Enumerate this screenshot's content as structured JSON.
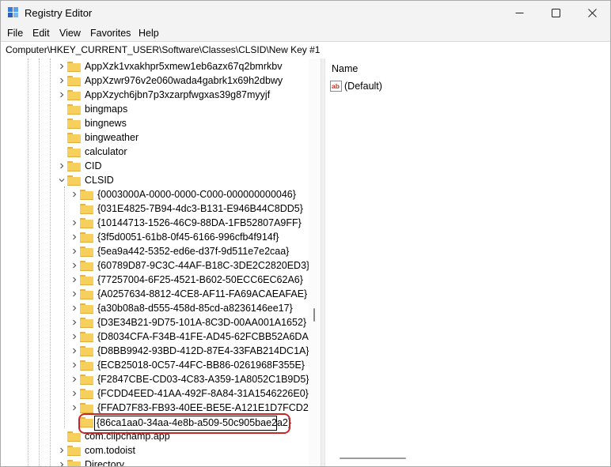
{
  "window": {
    "title": "Registry Editor",
    "icon": "registry-icon",
    "controls": [
      "minimize-icon",
      "maximize-icon",
      "close-icon"
    ]
  },
  "menu": [
    "File",
    "Edit",
    "View",
    "Favorites",
    "Help"
  ],
  "address": "Computer\\HKEY_CURRENT_USER\\Software\\Classes\\CLSID\\New Key #1",
  "tree": {
    "items": [
      {
        "label": "AppXzk1vxakhpr5xmew1eb6azx67q2bmrkbv",
        "expandable": true
      },
      {
        "label": "AppXzwr976v2e060wada4gabrk1x69h2dbwy",
        "expandable": true
      },
      {
        "label": "AppXzych6jbn7p3xzarpfwgxas39g87myyjf",
        "expandable": true
      },
      {
        "label": "bingmaps",
        "expandable": false
      },
      {
        "label": "bingnews",
        "expandable": false
      },
      {
        "label": "bingweather",
        "expandable": false
      },
      {
        "label": "calculator",
        "expandable": false
      },
      {
        "label": "CID",
        "expandable": true
      },
      {
        "label": "CLSID",
        "expandable": true,
        "expanded": true
      }
    ],
    "clsid_children": [
      {
        "label": "{0003000A-0000-0000-C000-000000000046}",
        "expandable": true
      },
      {
        "label": "{031E4825-7B94-4dc3-B131-E946B44C8DD5}",
        "expandable": false
      },
      {
        "label": "{10144713-1526-46C9-88DA-1FB52807A9FF}",
        "expandable": true
      },
      {
        "label": "{3f5d0051-61b8-0f45-6166-996cfb4f914f}",
        "expandable": true
      },
      {
        "label": "{5ea9a442-5352-ed6e-d37f-9d511e7e2caa}",
        "expandable": true
      },
      {
        "label": "{60789D87-9C3C-44AF-B18C-3DE2C2820ED3}",
        "expandable": true
      },
      {
        "label": "{77257004-6F25-4521-B602-50ECC6EC62A6}",
        "expandable": true
      },
      {
        "label": "{A0257634-8812-4CE8-AF11-FA69ACAEAFAE}",
        "expandable": true
      },
      {
        "label": "{a30b08a8-d555-458d-85cd-a8236146ee17}",
        "expandable": true
      },
      {
        "label": "{D3E34B21-9D75-101A-8C3D-00AA001A1652}",
        "expandable": true
      },
      {
        "label": "{D8034CFA-F34B-41FE-AD45-62FCBB52A6DA}",
        "expandable": true
      },
      {
        "label": "{D8BB9942-93BD-412D-87E4-33FAB214DC1A}",
        "expandable": true
      },
      {
        "label": "{ECB25018-0C57-44FC-BB86-0261968F355E}",
        "expandable": true
      },
      {
        "label": "{F2847CBE-CD03-4C83-A359-1A8052C1B9D5}",
        "expandable": true
      },
      {
        "label": "{FCDD4EED-41AA-492F-8A84-31A1546226E0}",
        "expandable": true
      },
      {
        "label": "{FFAD7F83-FB93-40EE-BE5E-A121E1D7FCD2}",
        "expandable": true
      }
    ],
    "editing": {
      "value": "{86ca1aa0-34aa-4e8b-a509-50c905bae2a2}"
    },
    "after": [
      {
        "label": "com.clipchamp.app",
        "expandable": false
      },
      {
        "label": "com.todoist",
        "expandable": true
      },
      {
        "label": "Directory",
        "expandable": true
      }
    ]
  },
  "values": {
    "header": "Name",
    "rows": [
      {
        "name": "(Default)",
        "icon": "string-value-icon"
      }
    ]
  },
  "colors": {
    "folder": "#f7cf5c",
    "highlight": "#c62828"
  }
}
